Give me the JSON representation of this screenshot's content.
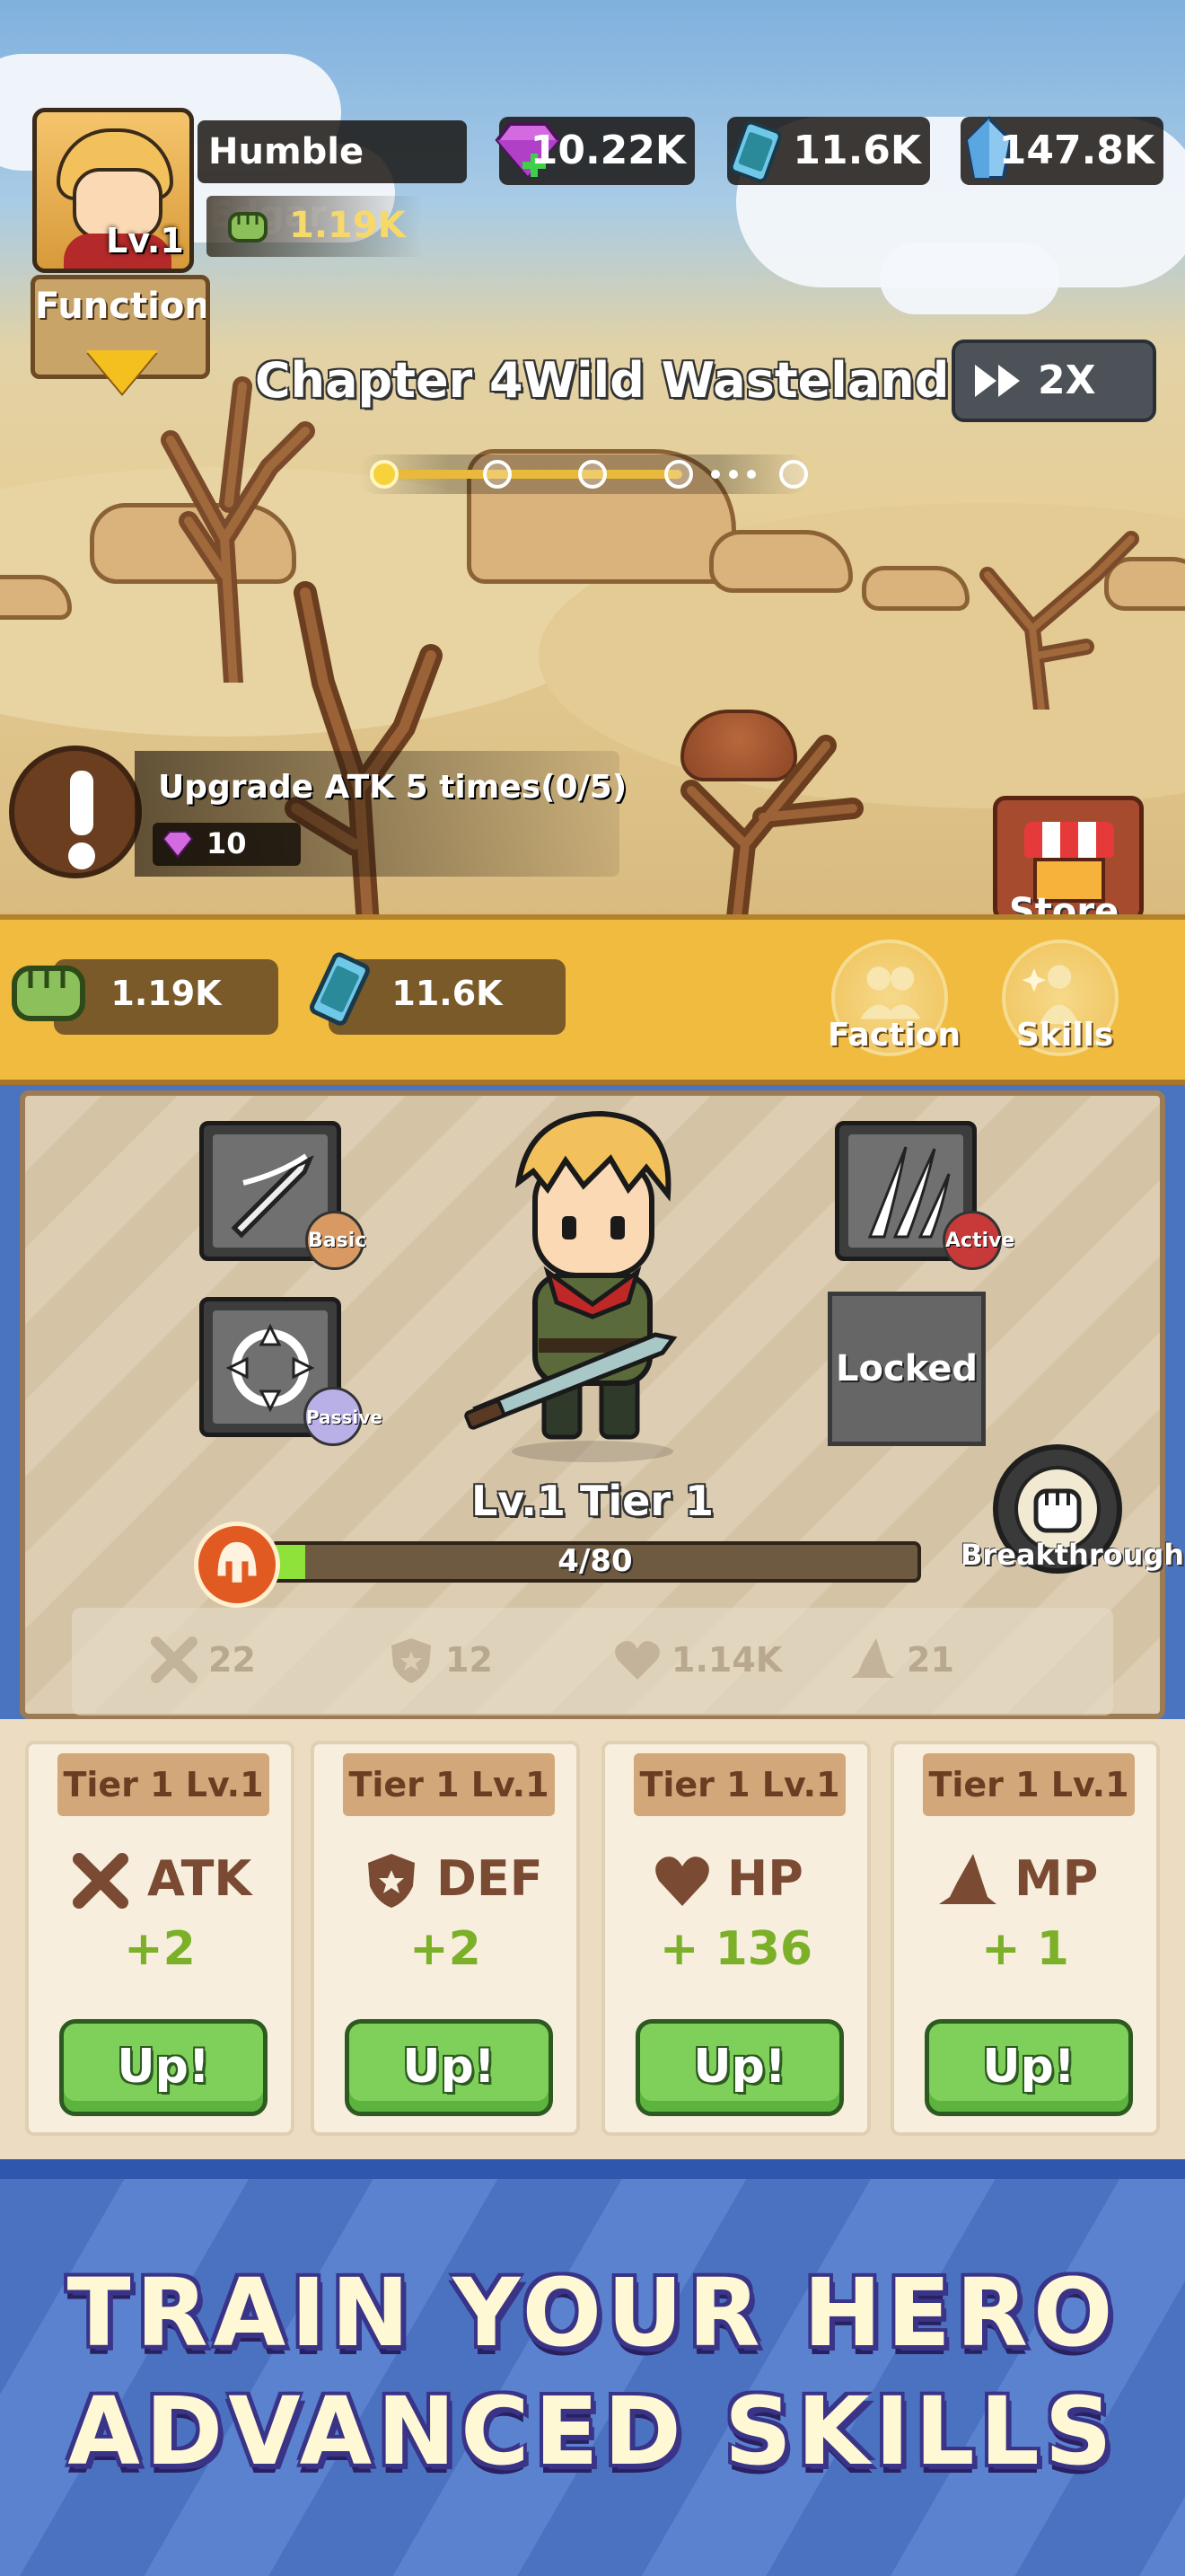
{
  "player": {
    "name": "Humble Edgar",
    "level_badge": "Lv.1",
    "power": "1.19K"
  },
  "resources": {
    "gems": "10.22K",
    "energy_cells": "11.6K",
    "crystals": "147.8K"
  },
  "functions_button": "Functions",
  "chapter": {
    "title": "Chapter 4Wild Wasteland",
    "speed_label": "2X",
    "stages_completed": 1,
    "stages_shown": 5
  },
  "quest": {
    "text": "Upgrade ATK 5 times(0/5)",
    "reward": "10"
  },
  "store_label": "Store",
  "band": {
    "power": "1.19K",
    "energy": "11.6K",
    "faction_label": "Faction",
    "skills_label": "Skills"
  },
  "skills": {
    "basic_tag": "Basic",
    "active_tag": "Active",
    "passive_tag": "Passive",
    "locked_label": "Locked"
  },
  "hero": {
    "tier_label": "Lv.1 Tier 1",
    "xp_text": "4/80",
    "xp_fraction": 0.05,
    "breakthrough_label": "Breakthrough"
  },
  "stats": {
    "atk": "22",
    "def": "12",
    "hp": "1.14K",
    "mp": "21"
  },
  "cards": [
    {
      "tier": "Tier 1 Lv.1",
      "name": "ATK",
      "gain": "+2",
      "button": "Up!"
    },
    {
      "tier": "Tier 1 Lv.1",
      "name": "DEF",
      "gain": "+2",
      "button": "Up!"
    },
    {
      "tier": "Tier 1 Lv.1",
      "name": "HP",
      "gain": "+ 136",
      "button": "Up!"
    },
    {
      "tier": "Tier 1 Lv.1",
      "name": "MP",
      "gain": "+ 1",
      "button": "Up!"
    }
  ],
  "promo": {
    "line1": "TRAIN YOUR HERO",
    "line2": "ADVANCED SKILLS"
  },
  "colors": {
    "band": "#f0bb3e",
    "up_button": "#7fd05a",
    "xp_fill": "#8fe23a",
    "stat_text": "#7a4a32",
    "gain_text": "#7bb028"
  }
}
